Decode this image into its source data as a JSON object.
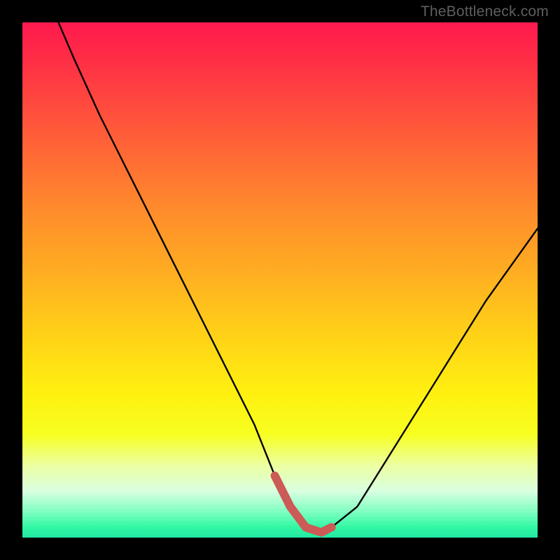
{
  "watermark": "TheBottleneck.com",
  "colors": {
    "frame": "#000000",
    "curve_stroke": "#000000",
    "accent_stroke": "#cc5a56",
    "watermark_text": "#5f5f5f"
  },
  "chart_data": {
    "type": "line",
    "title": "",
    "xlabel": "",
    "ylabel": "",
    "xlim": [
      0,
      100
    ],
    "ylim": [
      0,
      100
    ],
    "grid": false,
    "series": [
      {
        "name": "bottleneck-curve",
        "x": [
          7,
          10,
          15,
          20,
          25,
          30,
          35,
          40,
          45,
          49,
          52,
          55,
          58,
          60,
          65,
          70,
          75,
          80,
          85,
          90,
          95,
          100
        ],
        "values": [
          100,
          93,
          82,
          72,
          62,
          52,
          42,
          32,
          22,
          12,
          6,
          2,
          1,
          2,
          6,
          14,
          22,
          30,
          38,
          46,
          53,
          60
        ]
      }
    ],
    "highlight_segment": {
      "name": "valley-bottom",
      "x": [
        49,
        52,
        55,
        58,
        60
      ],
      "values": [
        12,
        6,
        2,
        1,
        2
      ]
    },
    "background_gradient_stops": [
      {
        "pct": 0,
        "color": "#ff1a4f"
      },
      {
        "pct": 50,
        "color": "#ffb81f"
      },
      {
        "pct": 78,
        "color": "#fff010"
      },
      {
        "pct": 100,
        "color": "#20e8a0"
      }
    ]
  }
}
